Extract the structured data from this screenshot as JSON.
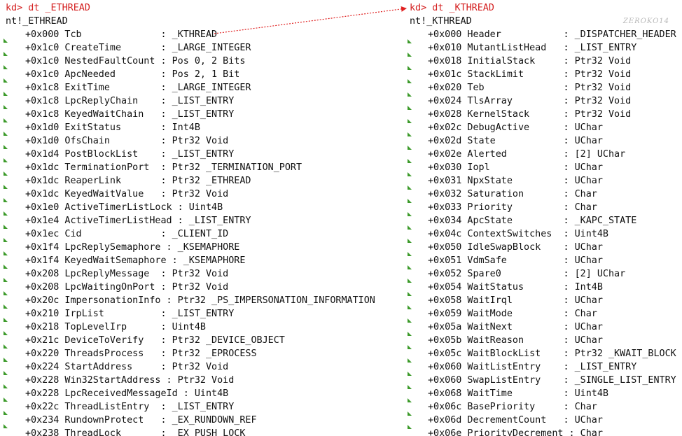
{
  "colors": {
    "command": "#d42020",
    "text": "#111111",
    "marker": "#3c9a2a",
    "arrow": "#e02020",
    "watermark": "#b8b8b8"
  },
  "left": {
    "prompt": "kd>",
    "command": "dt _ETHREAD",
    "type_header": "nt!_ETHREAD",
    "rows": [
      "+0x000 Tcb              : _KTHREAD",
      "+0x1c0 CreateTime       : _LARGE_INTEGER",
      "+0x1c0 NestedFaultCount : Pos 0, 2 Bits",
      "+0x1c0 ApcNeeded        : Pos 2, 1 Bit",
      "+0x1c8 ExitTime         : _LARGE_INTEGER",
      "+0x1c8 LpcReplyChain    : _LIST_ENTRY",
      "+0x1c8 KeyedWaitChain   : _LIST_ENTRY",
      "+0x1d0 ExitStatus       : Int4B",
      "+0x1d0 OfsChain         : Ptr32 Void",
      "+0x1d4 PostBlockList    : _LIST_ENTRY",
      "+0x1dc TerminationPort  : Ptr32 _TERMINATION_PORT",
      "+0x1dc ReaperLink       : Ptr32 _ETHREAD",
      "+0x1dc KeyedWaitValue   : Ptr32 Void",
      "+0x1e0 ActiveTimerListLock : Uint4B",
      "+0x1e4 ActiveTimerListHead : _LIST_ENTRY",
      "+0x1ec Cid              : _CLIENT_ID",
      "+0x1f4 LpcReplySemaphore : _KSEMAPHORE",
      "+0x1f4 KeyedWaitSemaphore : _KSEMAPHORE",
      "+0x208 LpcReplyMessage  : Ptr32 Void",
      "+0x208 LpcWaitingOnPort : Ptr32 Void",
      "+0x20c ImpersonationInfo : Ptr32 _PS_IMPERSONATION_INFORMATION",
      "+0x210 IrpList          : _LIST_ENTRY",
      "+0x218 TopLevelIrp      : Uint4B",
      "+0x21c DeviceToVerify   : Ptr32 _DEVICE_OBJECT",
      "+0x220 ThreadsProcess   : Ptr32 _EPROCESS",
      "+0x224 StartAddress     : Ptr32 Void",
      "+0x228 Win32StartAddress : Ptr32 Void",
      "+0x228 LpcReceivedMessageId : Uint4B",
      "+0x22c ThreadListEntry  : _LIST_ENTRY",
      "+0x234 RundownProtect   : _EX_RUNDOWN_REF",
      "+0x238 ThreadLock       : _EX_PUSH_LOCK"
    ]
  },
  "right": {
    "prompt": "kd>",
    "command": "dt _KTHREAD",
    "type_header": "nt!_KTHREAD",
    "watermark": "ZEROKO14",
    "rows": [
      "+0x000 Header           : _DISPATCHER_HEADER",
      "+0x010 MutantListHead   : _LIST_ENTRY",
      "+0x018 InitialStack     : Ptr32 Void",
      "+0x01c StackLimit       : Ptr32 Void",
      "+0x020 Teb              : Ptr32 Void",
      "+0x024 TlsArray         : Ptr32 Void",
      "+0x028 KernelStack      : Ptr32 Void",
      "+0x02c DebugActive      : UChar",
      "+0x02d State            : UChar",
      "+0x02e Alerted          : [2] UChar",
      "+0x030 Iopl             : UChar",
      "+0x031 NpxState         : UChar",
      "+0x032 Saturation       : Char",
      "+0x033 Priority         : Char",
      "+0x034 ApcState         : _KAPC_STATE",
      "+0x04c ContextSwitches  : Uint4B",
      "+0x050 IdleSwapBlock    : UChar",
      "+0x051 VdmSafe          : UChar",
      "+0x052 Spare0           : [2] UChar",
      "+0x054 WaitStatus       : Int4B",
      "+0x058 WaitIrql         : UChar",
      "+0x059 WaitMode         : Char",
      "+0x05a WaitNext         : UChar",
      "+0x05b WaitReason       : UChar",
      "+0x05c WaitBlockList    : Ptr32 _KWAIT_BLOCK",
      "+0x060 WaitListEntry    : _LIST_ENTRY",
      "+0x060 SwapListEntry    : _SINGLE_LIST_ENTRY",
      "+0x068 WaitTime         : Uint4B",
      "+0x06c BasePriority     : Char",
      "+0x06d DecrementCount   : UChar",
      "+0x06e PriorityDecrement : Char"
    ]
  }
}
